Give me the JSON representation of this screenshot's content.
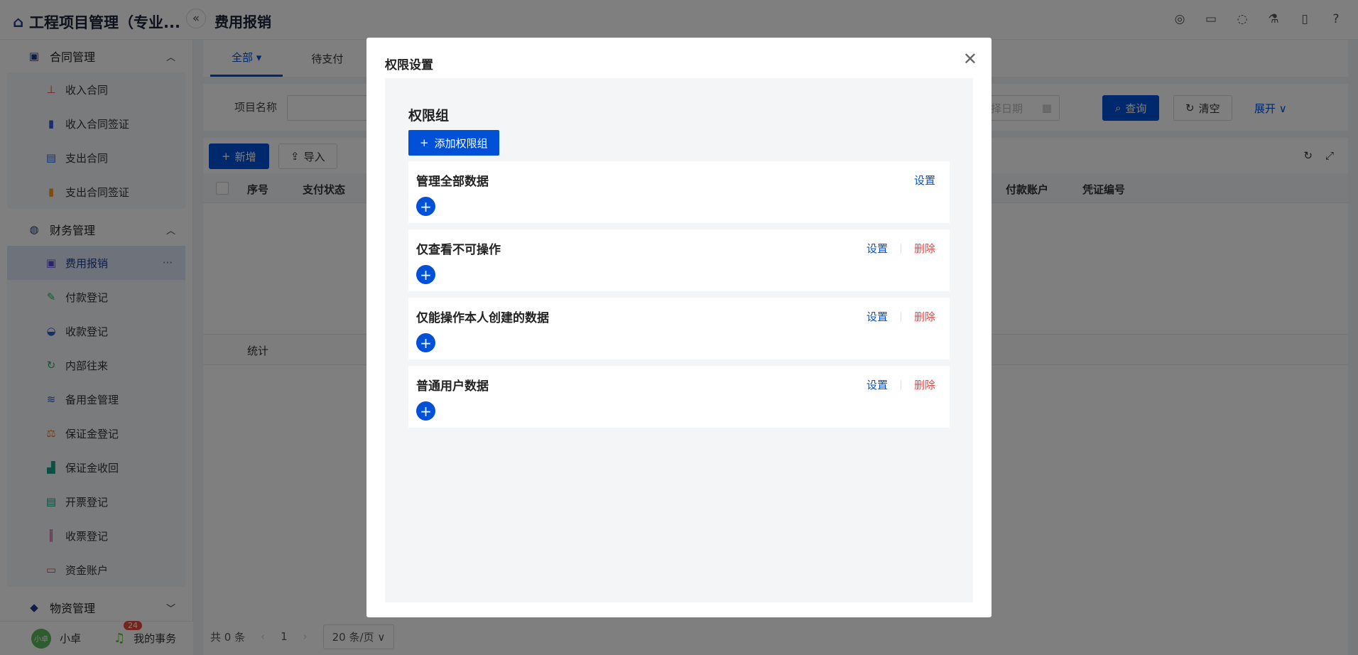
{
  "app": {
    "title": "工程项目管理（专业...",
    "page_title": "费用报销"
  },
  "sidebar": {
    "groups": [
      {
        "label": "合同管理",
        "items": [
          "收入合同",
          "收入合同签证",
          "支出合同",
          "支出合同签证"
        ]
      },
      {
        "label": "财务管理",
        "items": [
          "费用报销",
          "付款登记",
          "收款登记",
          "内部往来",
          "备用金管理",
          "保证金登记",
          "保证金收回",
          "开票登记",
          "收票登记",
          "资金账户"
        ]
      },
      {
        "label": "物资管理"
      }
    ],
    "user": {
      "avatar": "小卓",
      "name": "小卓"
    },
    "tasks": {
      "label": "我的事务",
      "count": "24"
    }
  },
  "main": {
    "tabs": [
      "全部",
      "待支付"
    ],
    "filter": {
      "project_label": "项目名称",
      "date_placeholder": "择日期",
      "query": "查询",
      "clear": "清空",
      "expand": "展开"
    },
    "toolbar": {
      "add": "新增",
      "import": "导入"
    },
    "columns": [
      "序号",
      "支付状态",
      "付款账户",
      "凭证编号"
    ],
    "summary_label": "统计",
    "pager": {
      "total": "共 0 条",
      "page": "1",
      "size": "20 条/页"
    }
  },
  "modal": {
    "title": "权限设置",
    "heading": "权限组",
    "add_button": "添加权限组",
    "set_label": "设置",
    "delete_label": "删除",
    "groups": [
      {
        "name": "管理全部数据"
      },
      {
        "name": "仅查看不可操作"
      },
      {
        "name": "仅能操作本人创建的数据"
      },
      {
        "name": "普通用户数据"
      }
    ]
  },
  "colors": {
    "primary": "#0050d8",
    "danger": "#e84545"
  }
}
